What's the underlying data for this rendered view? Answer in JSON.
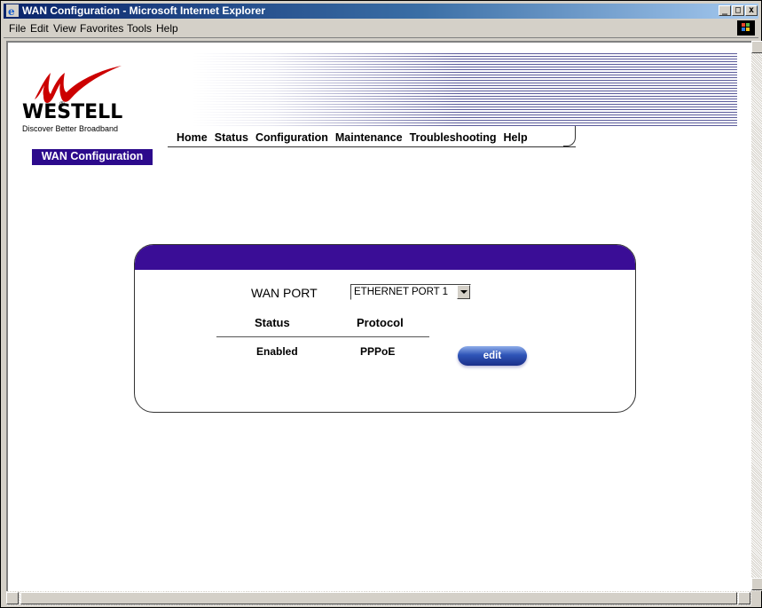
{
  "window": {
    "title": "WAN Configuration - Microsoft Internet Explorer",
    "minimize_glyph": "_",
    "maximize_glyph": "□",
    "close_glyph": "x"
  },
  "menu": {
    "items": [
      "File",
      "Edit",
      "View",
      "Favorites",
      "Tools",
      "Help"
    ]
  },
  "brand": {
    "name": "WESTELL",
    "tagline": "Discover Better Broadband",
    "registered": "®",
    "accent_color": "#cc0000"
  },
  "nav": {
    "items": [
      "Home",
      "Status",
      "Configuration",
      "Maintenance",
      "Troubleshooting",
      "Help"
    ]
  },
  "section": {
    "title": "WAN Configuration",
    "color": "#2c0a8c"
  },
  "wan": {
    "port_label": "WAN PORT",
    "port_selected": "ETHERNET PORT 1",
    "columns": [
      "Status",
      "Protocol"
    ],
    "row": {
      "status": "Enabled",
      "protocol": "PPPoE"
    },
    "edit_label": "edit"
  },
  "icons": {
    "ie": "ie-logo-icon",
    "windows": "windows-flag-icon",
    "dropdown": "chevron-down-icon"
  }
}
